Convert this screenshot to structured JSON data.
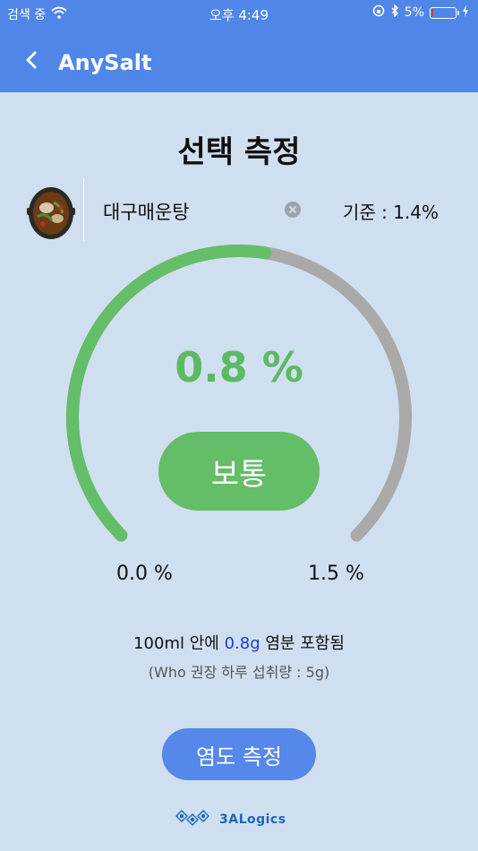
{
  "status_bar": {
    "carrier": "검색 중",
    "time": "오후 4:49",
    "battery_text": "5%",
    "battery_level_percent": 5
  },
  "nav": {
    "title": "AnySalt"
  },
  "page": {
    "title": "선택 측정"
  },
  "food": {
    "name": "대구매운탕",
    "standard": "기준 : 1.4%"
  },
  "gauge": {
    "value_text": "0.8 %",
    "value": 0.8,
    "min": 0.0,
    "max": 1.5,
    "min_label": "0.0 %",
    "max_label": "1.5 %",
    "level_label": "보통",
    "fill_color": "#64bd67",
    "track_color": "#a9a9a9"
  },
  "salt_info": {
    "prefix": "100ml 안에 ",
    "amount": "0.8g",
    "suffix": " 염분 포함됨",
    "who": "(Who 권장 하루 섭취량 : 5g)"
  },
  "actions": {
    "measure_label": "염도 측정"
  },
  "footer": {
    "company": "3ALogics"
  },
  "colors": {
    "header": "#4f86e8",
    "background": "#cfdff0",
    "accent_green": "#64bd67",
    "button_blue": "#5588ea",
    "salt_amount_blue": "#1e3adf"
  }
}
